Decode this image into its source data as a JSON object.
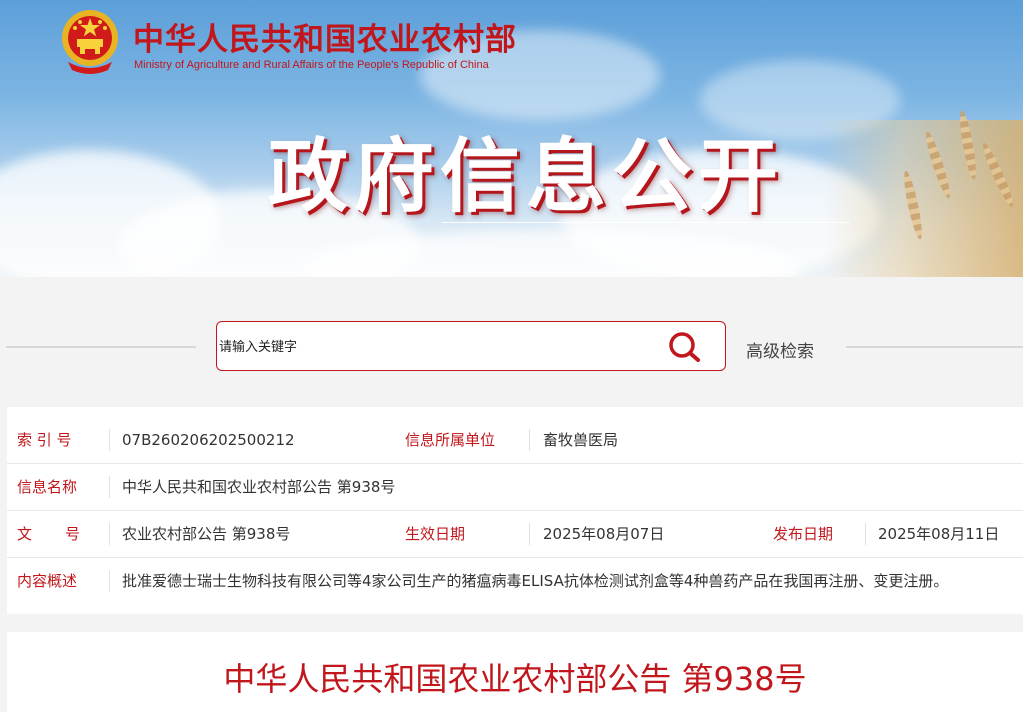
{
  "header": {
    "site_title_cn": "中华人民共和国农业农村部",
    "site_title_en": "Ministry of Agriculture and Rural Affairs of the People's Republic of China",
    "banner_title": "政府信息公开"
  },
  "search": {
    "placeholder": "请输入关键字",
    "icon": "search-icon",
    "advanced_label": "高级检索"
  },
  "info": {
    "index_no_label": "索 引 号",
    "index_no_value": "07B260206202500212",
    "owner_label": "信息所属单位",
    "owner_value": "畜牧兽医局",
    "name_label": "信息名称",
    "name_value": "中华人民共和国农业农村部公告 第938号",
    "doc_no_label_1": "文",
    "doc_no_label_2": "号",
    "doc_no_value": "农业农村部公告 第938号",
    "effective_label": "生效日期",
    "effective_value": "2025年08月07日",
    "publish_label": "发布日期",
    "publish_value": "2025年08月11日",
    "summary_label": "内容概述",
    "summary_value": "批准爱德士瑞士生物科技有限公司等4家公司生产的猪瘟病毒ELISA抗体检测试剂盒等4种兽药产品在我国再注册、变更注册。"
  },
  "article": {
    "title": "中华人民共和国农业农村部公告 第938号"
  },
  "colors": {
    "accent": "#c1161c",
    "background": "#f3f3f3"
  }
}
